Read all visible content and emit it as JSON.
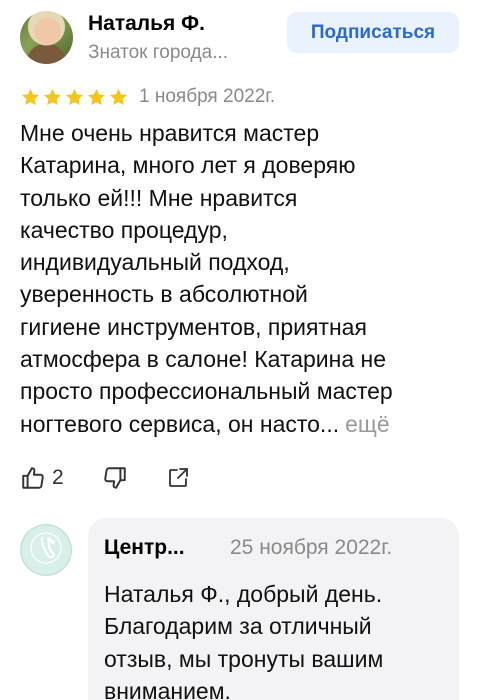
{
  "author": {
    "name": "Наталья Ф.",
    "level": "Знаток города..."
  },
  "subscribe_label": "Подписаться",
  "rating": {
    "stars": 5,
    "max": 5,
    "color": "#f5c518"
  },
  "review": {
    "date": "1 ноября 2022г.",
    "lines": [
      "Мне очень нравится мастер",
      "Катарина, много лет я доверяю",
      "только ей!!! Мне нравится",
      "качество процедур,",
      "индивидуальный подход,",
      "уверенность в абсолютной",
      "гигиене инструментов, приятная",
      "атмосфера в салоне! Катарина не",
      "просто профессиональный мастер",
      "ногтевого сервиса, он насто..."
    ],
    "more_label": "ещё"
  },
  "actions": {
    "like_icon": "thumbs-up-icon",
    "like_count": "2",
    "dislike_icon": "thumbs-down-icon",
    "share_icon": "share-icon"
  },
  "reply": {
    "author": "Центр...",
    "date": "25 ноября 2022г.",
    "lines": [
      "Наталья Ф., добрый день.",
      "Благодарим за отличный",
      "отзыв, мы тронуты вашим",
      "вниманием."
    ]
  },
  "colors": {
    "accent": "#2a6ad2",
    "accent_bg": "#eaf2fd",
    "muted": "#8a8a8a",
    "reply_bg": "#f3f3f5"
  }
}
